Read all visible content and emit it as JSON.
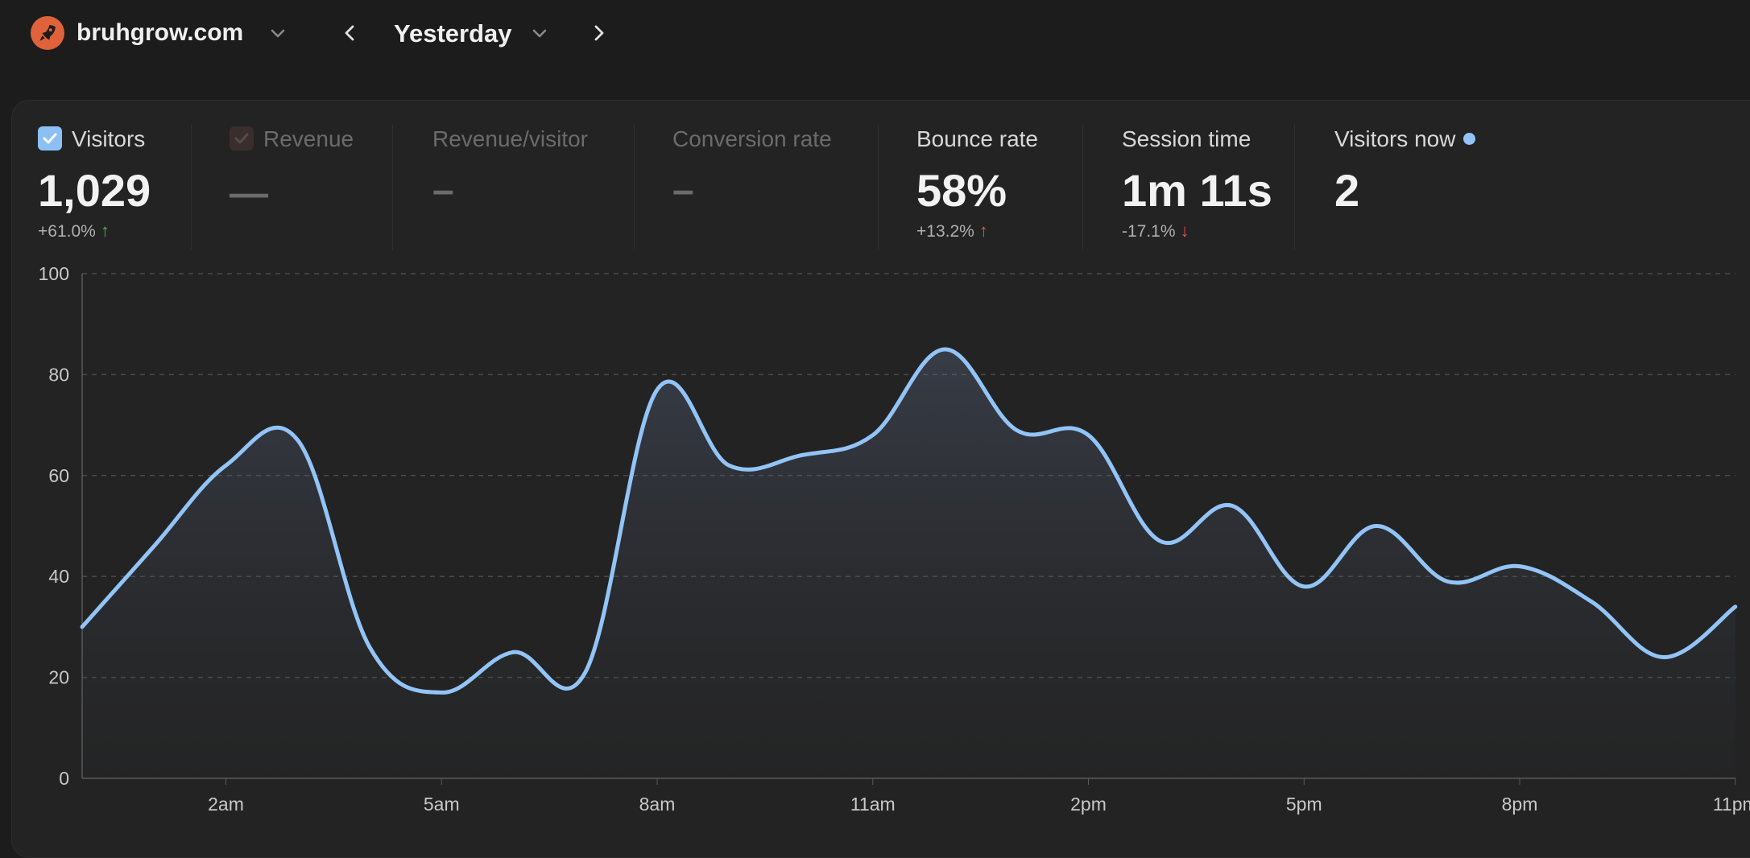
{
  "header": {
    "site_name": "bruhgrow.com",
    "period": "Yesterday",
    "logo_icon": "rocket-icon",
    "icons": [
      "chevron-down-icon",
      "chevron-left-icon",
      "chevron-down-icon",
      "chevron-right-icon"
    ]
  },
  "metrics": {
    "visitors": {
      "label": "Visitors",
      "value": "1,029",
      "change": "+61.0%",
      "arrow": "↑",
      "checked": true
    },
    "revenue": {
      "label": "Revenue",
      "value": "—",
      "checked": true
    },
    "revenue_per_visitor": {
      "label": "Revenue/visitor",
      "value": "–"
    },
    "conversion_rate": {
      "label": "Conversion rate",
      "value": "–"
    },
    "bounce_rate": {
      "label": "Bounce rate",
      "value": "58%",
      "change": "+13.2%",
      "arrow": "↑"
    },
    "session_time": {
      "label": "Session time",
      "value": "1m 11s",
      "change": "-17.1%",
      "arrow": "↓"
    },
    "visitors_now": {
      "label": "Visitors now",
      "value": "2"
    }
  },
  "colors": {
    "line": "#92c4f7",
    "up_good": "#3fb950",
    "up_bad": "#e5534b",
    "down_bad": "#e5534b"
  },
  "chart_data": {
    "type": "area",
    "series": [
      {
        "x": [
          "12am",
          "1am",
          "2am",
          "3am",
          "4am",
          "5am",
          "6am",
          "7am",
          "8am",
          "9am",
          "10am",
          "11am",
          "12pm",
          "1pm",
          "2pm",
          "3pm",
          "4pm",
          "5pm",
          "6pm",
          "7pm",
          "8pm",
          "9pm",
          "10pm",
          "11pm"
        ],
        "values": [
          30,
          46,
          62,
          67,
          26,
          17,
          25,
          21,
          77,
          62,
          64,
          68,
          85,
          69,
          68,
          47,
          54,
          38,
          50,
          39,
          42,
          35,
          24,
          34
        ]
      }
    ],
    "x_tick_labels": [
      "2am",
      "5am",
      "8am",
      "11am",
      "2pm",
      "5pm",
      "8pm",
      "11pm"
    ],
    "y_ticks": [
      0,
      20,
      40,
      60,
      80,
      100
    ],
    "ylim": [
      0,
      100
    ],
    "grid": true
  }
}
